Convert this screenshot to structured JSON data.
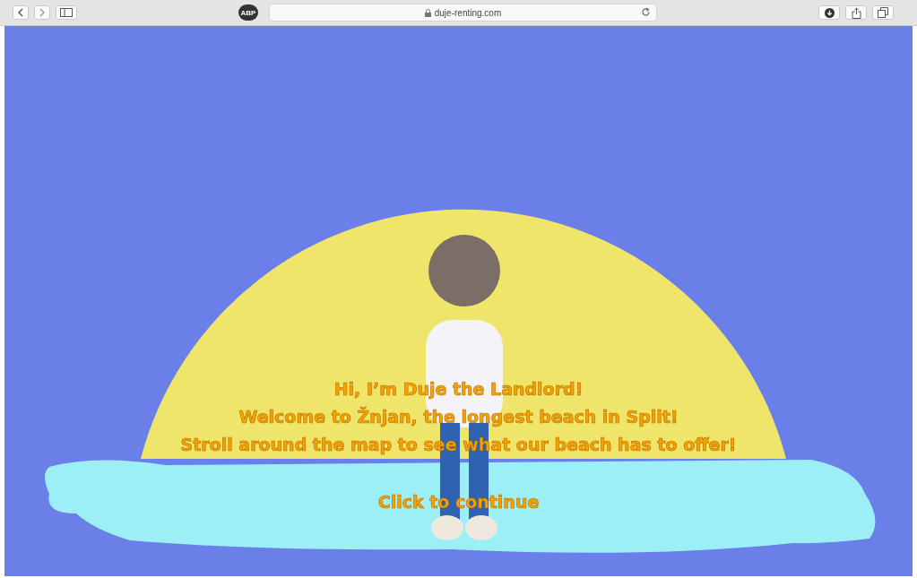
{
  "browser": {
    "extension_badge": "ABP",
    "address": "duje-renting.com"
  },
  "intro": {
    "lines": [
      "Hi, I’m Duje the Landlord!",
      "Welcome to Žnjan, the longest beach in Split!",
      "Stroll around the map to see what our beach has to offer!"
    ],
    "continue": "Click to continue"
  }
}
